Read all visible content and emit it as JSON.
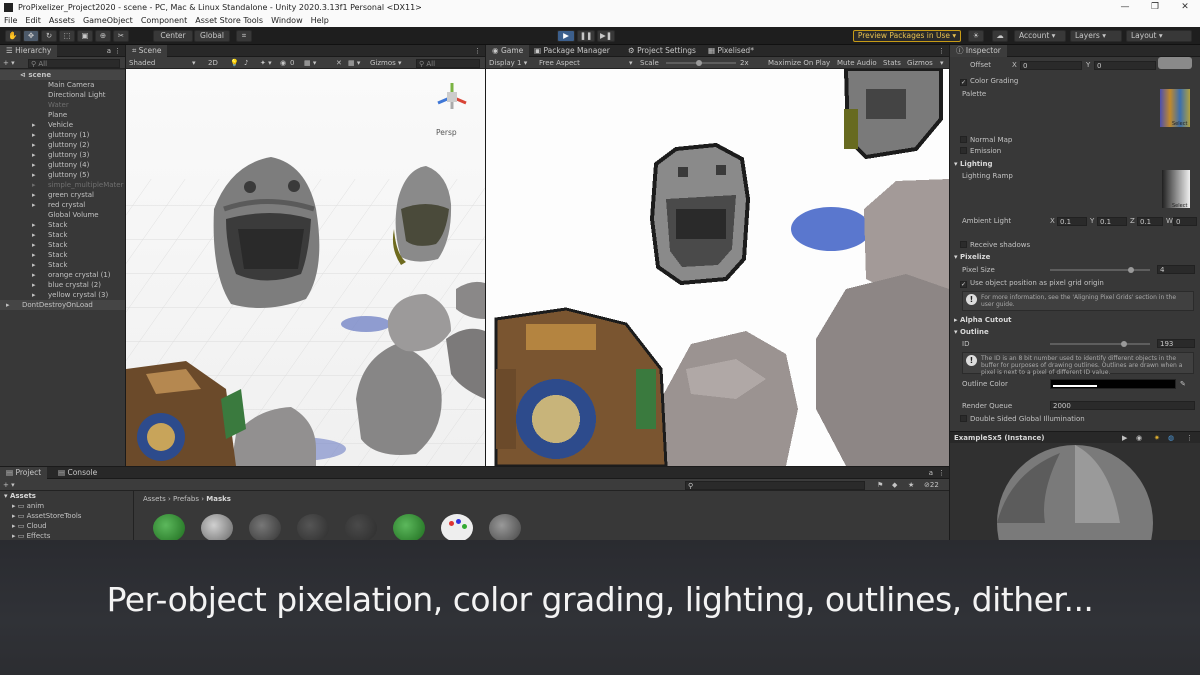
{
  "window": {
    "title": "ProPixelizer_Project2020 - scene - PC, Mac & Linux Standalone - Unity 2020.3.13f1 Personal <DX11>",
    "controls": [
      "—",
      "❐",
      "✕"
    ]
  },
  "menu": [
    "File",
    "Edit",
    "Assets",
    "GameObject",
    "Component",
    "Asset Store Tools",
    "Window",
    "Help"
  ],
  "toolbar": {
    "center": "Center",
    "global": "Global",
    "play": "▶",
    "pause": "❚❚",
    "step": "▶❚",
    "preview_packages": "Preview Packages in Use ▾",
    "account": "Account",
    "layers": "Layers",
    "layout": "Layout"
  },
  "hierarchy": {
    "tab": "Hierarchy",
    "search": "All",
    "scene": "scene",
    "items": [
      {
        "label": "Main Camera",
        "indent": 1,
        "dim": false,
        "arrow": false
      },
      {
        "label": "Directional Light",
        "indent": 1,
        "dim": false,
        "arrow": false
      },
      {
        "label": "Water",
        "indent": 1,
        "dim": true,
        "arrow": false
      },
      {
        "label": "Plane",
        "indent": 1,
        "dim": false,
        "arrow": false
      },
      {
        "label": "Vehicle",
        "indent": 1,
        "dim": false,
        "arrow": true
      },
      {
        "label": "gluttony (1)",
        "indent": 1,
        "dim": false,
        "arrow": true
      },
      {
        "label": "gluttony (2)",
        "indent": 1,
        "dim": false,
        "arrow": true
      },
      {
        "label": "gluttony (3)",
        "indent": 1,
        "dim": false,
        "arrow": true
      },
      {
        "label": "gluttony (4)",
        "indent": 1,
        "dim": false,
        "arrow": true
      },
      {
        "label": "gluttony (5)",
        "indent": 1,
        "dim": false,
        "arrow": true
      },
      {
        "label": "simple_multipleMater",
        "indent": 1,
        "dim": true,
        "arrow": true
      },
      {
        "label": "green crystal",
        "indent": 1,
        "dim": false,
        "arrow": true
      },
      {
        "label": "red crystal",
        "indent": 1,
        "dim": false,
        "arrow": true
      },
      {
        "label": "Global Volume",
        "indent": 1,
        "dim": false,
        "arrow": false
      },
      {
        "label": "Stack",
        "indent": 1,
        "dim": false,
        "arrow": true
      },
      {
        "label": "Stack",
        "indent": 1,
        "dim": false,
        "arrow": true
      },
      {
        "label": "Stack",
        "indent": 1,
        "dim": false,
        "arrow": true
      },
      {
        "label": "Stack",
        "indent": 1,
        "dim": false,
        "arrow": true
      },
      {
        "label": "Stack",
        "indent": 1,
        "dim": false,
        "arrow": true
      },
      {
        "label": "orange crystal (1)",
        "indent": 1,
        "dim": false,
        "arrow": true
      },
      {
        "label": "blue crystal (2)",
        "indent": 1,
        "dim": false,
        "arrow": true
      },
      {
        "label": "yellow crystal (3)",
        "indent": 1,
        "dim": false,
        "arrow": true
      },
      {
        "label": "DontDestroyOnLoad",
        "indent": 0,
        "dim": false,
        "arrow": true
      }
    ]
  },
  "scene_view": {
    "tab": "Scene",
    "shading": "Shaded",
    "mode_2d": "2D",
    "gizmos": "Gizmos",
    "search": "All",
    "persp": "Persp",
    "hidden_count": "0"
  },
  "game_view": {
    "tabs": [
      "Game",
      "Package Manager",
      "Project Settings",
      "Pixelised*"
    ],
    "display": "Display 1",
    "aspect": "Free Aspect",
    "scale_label": "Scale",
    "scale_value": "2x",
    "buttons": [
      "Maximize On Play",
      "Mute Audio",
      "Stats",
      "Gizmos"
    ]
  },
  "inspector": {
    "tab": "Inspector",
    "offset": {
      "label": "Offset",
      "x_label": "X",
      "x": "0",
      "y_label": "Y",
      "y": "0"
    },
    "color_grading": "Color Grading",
    "palette": "Palette",
    "select": "Select",
    "normal_map": "Normal Map",
    "emission": "Emission",
    "lighting": "Lighting",
    "lighting_ramp": "Lighting Ramp",
    "ambient": {
      "label": "Ambient Light",
      "x": "0.1",
      "y": "0.1",
      "z": "0.1",
      "w": "0",
      "x_label": "X",
      "y_label": "Y",
      "z_label": "Z",
      "w_label": "W"
    },
    "receive_shadows": "Receive shadows",
    "pixelize": "Pixelize",
    "pixel_size": {
      "label": "Pixel Size",
      "value": "4",
      "fraction": 0.83
    },
    "use_object_position": "Use object position as pixel grid origin",
    "info1": "For more information, see the 'Aligning Pixel Grids' section in the user guide.",
    "alpha_cutout": "Alpha Cutout",
    "outline": "Outline",
    "id": {
      "label": "ID",
      "value": "193",
      "fraction": 0.76
    },
    "info2": "The ID is an 8 bit number used to identify different objects in the buffer for purposes of drawing outlines. Outlines are drawn when a pixel is next to a pixel of different ID value.",
    "outline_color": "Outline Color",
    "render_queue": {
      "label": "Render Queue",
      "value": "2000"
    },
    "double_sided": "Double Sided Global Illumination",
    "preview_title": "ExampleSx5 (Instance)"
  },
  "project": {
    "tabs": [
      "Project",
      "Console"
    ],
    "assets_root": "Assets",
    "folders": [
      "anim",
      "AssetStoreTools",
      "Cloud",
      "Effects"
    ],
    "breadcrumb": [
      "Assets",
      "Prefabs",
      "Masks"
    ],
    "count": "22"
  },
  "caption": "Per-object pixelation, color grading, lighting, outlines, dither..."
}
